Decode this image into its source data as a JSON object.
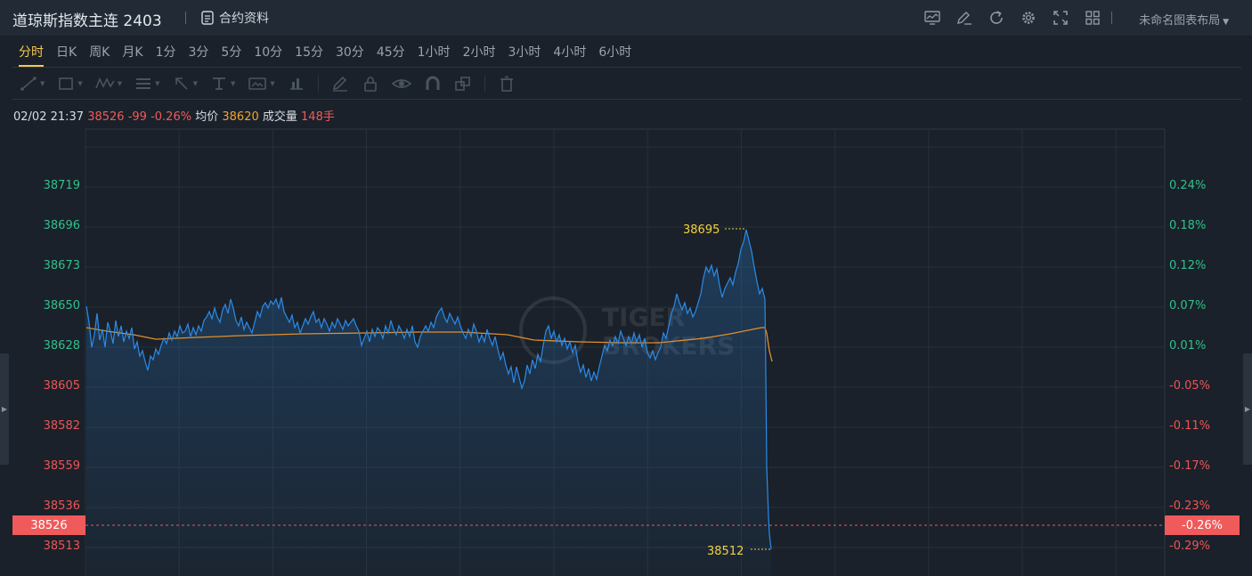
{
  "header": {
    "title": "道琼斯指数主连 2403",
    "contract_label": "合约资料",
    "layout_label": "未命名图表布局"
  },
  "periods": [
    "分时",
    "日K",
    "周K",
    "月K",
    "1分",
    "3分",
    "5分",
    "10分",
    "15分",
    "30分",
    "45分",
    "1小时",
    "2小时",
    "3小时",
    "4小时",
    "6小时"
  ],
  "active_period": "分时",
  "info": {
    "datetime": "02/02 21:37",
    "price": "38526",
    "change": "-99",
    "change_pct": "-0.26%",
    "avg_label": "均价",
    "avg_value": "38620",
    "vol_label": "成交量",
    "vol_value": "148手"
  },
  "y_axis_left": [
    "38719",
    "38696",
    "38673",
    "38650",
    "38628",
    "38605",
    "38582",
    "38559",
    "38536",
    "38513"
  ],
  "y_axis_right": [
    "0.24%",
    "0.18%",
    "0.12%",
    "0.07%",
    "0.01%",
    "-0.05%",
    "-0.11%",
    "-0.17%",
    "-0.23%",
    "-0.29%"
  ],
  "current_tag": {
    "price": "38526",
    "pct": "-0.26%"
  },
  "annotations": {
    "high": "38695",
    "low": "38512"
  },
  "watermark": [
    "TIGER",
    "BROKERS"
  ],
  "colors": {
    "price_line": "#2b8be8",
    "avg_line": "#e0902a",
    "up": "#2fc18a",
    "down": "#ee5454",
    "accent": "#f4c94d",
    "tag": "#f05a5a"
  }
}
